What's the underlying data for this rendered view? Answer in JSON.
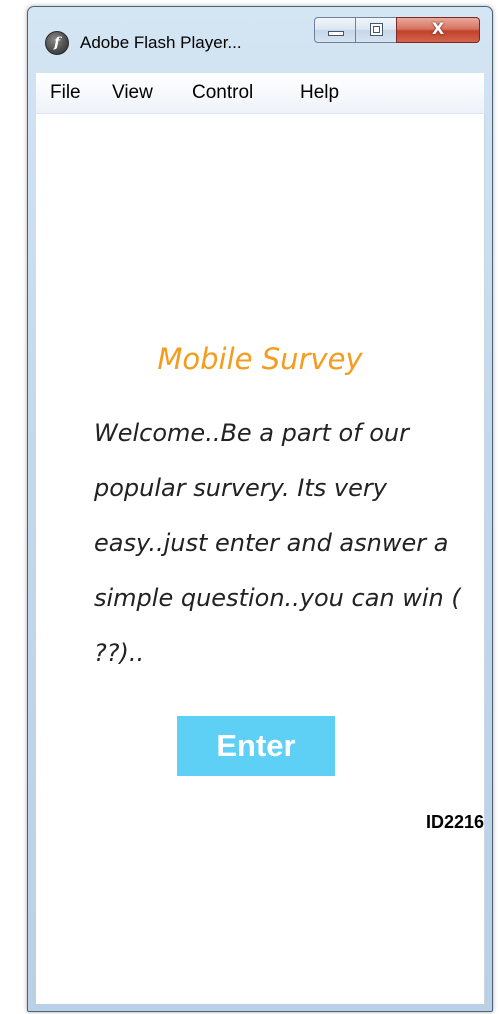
{
  "window": {
    "title": "Adobe Flash Player...",
    "app_icon_name": "adobe-flash-player-icon",
    "app_icon_glyph": "f",
    "controls": {
      "minimize_icon": "minimize-icon",
      "maximize_icon": "maximize-icon",
      "close_icon": "close-icon",
      "close_glyph": "X"
    }
  },
  "menu": {
    "items": [
      {
        "label": "File"
      },
      {
        "label": "View"
      },
      {
        "label": "Control"
      },
      {
        "label": "Help"
      }
    ]
  },
  "survey": {
    "title": "Mobile Survey",
    "welcome_text": "Welcome..Be a part of our popular survery. Its very easy..just enter and asnwer a simple question..you can win ( ??)..",
    "enter_label": "Enter",
    "id_label": "ID2216"
  },
  "colors": {
    "title_accent": "#f39c1e",
    "enter_button": "#5fd0f5",
    "close_button": "#c2412b"
  }
}
